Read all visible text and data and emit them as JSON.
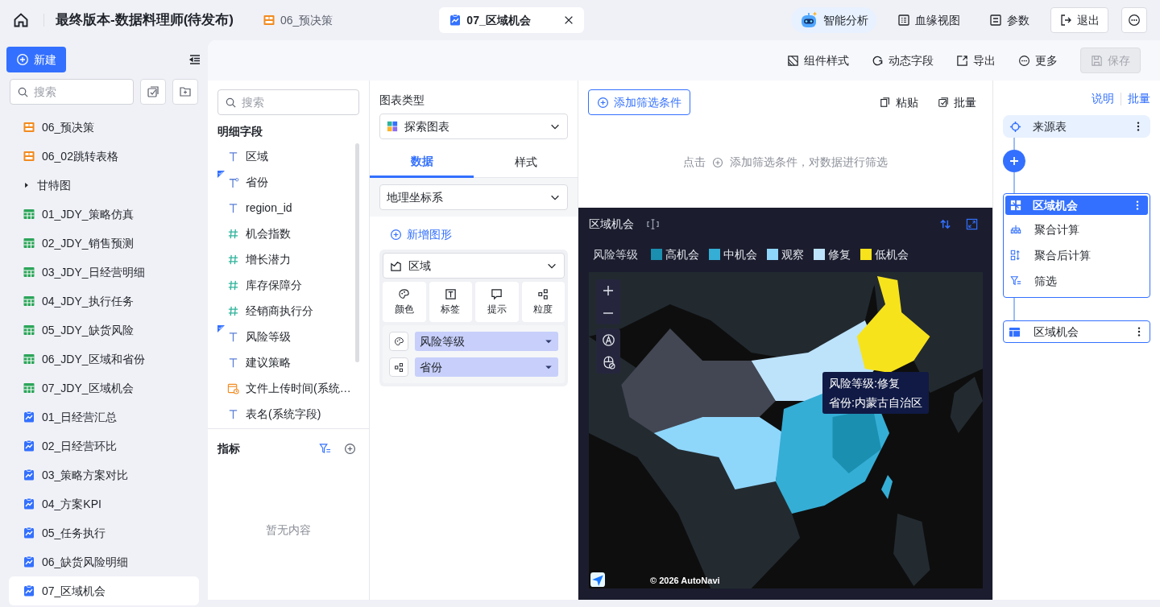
{
  "header": {
    "title": "最终版本-数据料理师(待发布)",
    "tabs": [
      {
        "label": "06_预决策",
        "kind": "dashboard",
        "selected": false
      },
      {
        "label": "07_区域机会",
        "kind": "chart",
        "selected": true
      }
    ],
    "actions": [
      {
        "label": "智能分析",
        "kind": "ai"
      },
      {
        "label": "血缘视图",
        "kind": "lineage"
      },
      {
        "label": "参数",
        "kind": "params"
      },
      {
        "label": "退出",
        "kind": "exit"
      }
    ]
  },
  "sidebar": {
    "new_button": "新建",
    "search_placeholder": "搜索",
    "items": [
      {
        "label": "06_预决策",
        "kind": "dashboard",
        "selected": false
      },
      {
        "label": "06_02跳转表格",
        "kind": "dashboard",
        "selected": false
      },
      {
        "label": "甘特图",
        "kind": "folder",
        "selected": false,
        "expanded": false
      },
      {
        "label": "01_JDY_策略仿真",
        "kind": "table",
        "selected": false
      },
      {
        "label": "02_JDY_销售预测",
        "kind": "table",
        "selected": false
      },
      {
        "label": "03_JDY_日经营明细",
        "kind": "table",
        "selected": false
      },
      {
        "label": "04_JDY_执行任务",
        "kind": "table",
        "selected": false
      },
      {
        "label": "05_JDY_缺货风险",
        "kind": "table",
        "selected": false
      },
      {
        "label": "06_JDY_区域和省份",
        "kind": "table",
        "selected": false
      },
      {
        "label": "07_JDY_区域机会",
        "kind": "table",
        "selected": false
      },
      {
        "label": "01_日经营汇总",
        "kind": "chart",
        "selected": false
      },
      {
        "label": "02_日经营环比",
        "kind": "chart",
        "selected": false
      },
      {
        "label": "03_策略方案对比",
        "kind": "chart",
        "selected": false
      },
      {
        "label": "04_方案KPI",
        "kind": "chart",
        "selected": false
      },
      {
        "label": "05_任务执行",
        "kind": "chart",
        "selected": false
      },
      {
        "label": "06_缺货风险明细",
        "kind": "chart",
        "selected": false
      },
      {
        "label": "07_区域机会",
        "kind": "chart",
        "selected": true
      }
    ]
  },
  "toolbar": [
    {
      "label": "组件样式",
      "kind": "style",
      "disabled": false
    },
    {
      "label": "动态字段",
      "kind": "dynamic",
      "disabled": false
    },
    {
      "label": "导出",
      "kind": "export",
      "disabled": false
    },
    {
      "label": "更多",
      "kind": "more",
      "disabled": false
    },
    {
      "label": "保存",
      "kind": "save",
      "disabled": true
    }
  ],
  "fields_panel": {
    "search_placeholder": "搜索",
    "detail_title": "明细字段",
    "fields": [
      {
        "label": "区域",
        "kind": "text",
        "used": false
      },
      {
        "label": "省份",
        "kind": "geo",
        "used": true
      },
      {
        "label": "region_id",
        "kind": "text",
        "used": false
      },
      {
        "label": "机会指数",
        "kind": "number",
        "used": false
      },
      {
        "label": "增长潜力",
        "kind": "number",
        "used": false
      },
      {
        "label": "库存保障分",
        "kind": "number",
        "used": false
      },
      {
        "label": "经销商执行分",
        "kind": "number",
        "used": false
      },
      {
        "label": "风险等级",
        "kind": "text",
        "used": true
      },
      {
        "label": "建议策略",
        "kind": "text",
        "used": false
      },
      {
        "label": "文件上传时间(系统…",
        "kind": "date",
        "used": false
      },
      {
        "label": "表名(系统字段)",
        "kind": "text",
        "used": false
      }
    ],
    "measures_title": "指标",
    "empty_text": "暂无内容"
  },
  "chart_config": {
    "type_label": "图表类型",
    "type_value": "探索图表",
    "tabs": [
      {
        "label": "数据",
        "selected": true
      },
      {
        "label": "样式",
        "selected": false
      }
    ],
    "coordinate": "地理坐标系",
    "add_shape": "新增图形",
    "layer": "区域",
    "channels": [
      {
        "label": "颜色",
        "kind": "color"
      },
      {
        "label": "标签",
        "kind": "label"
      },
      {
        "label": "提示",
        "kind": "tooltip"
      },
      {
        "label": "粒度",
        "kind": "detail"
      }
    ],
    "bindings": [
      {
        "kind": "color",
        "field": "风险等级"
      },
      {
        "kind": "detail",
        "field": "省份"
      }
    ]
  },
  "filter": {
    "add_button": "添加筛选条件",
    "actions": [
      {
        "label": "粘贴",
        "kind": "paste"
      },
      {
        "label": "批量",
        "kind": "batch"
      }
    ],
    "hint_prefix": "点击",
    "hint_text": "添加筛选条件，对数据进行筛选"
  },
  "chart": {
    "title": "区域机会",
    "legend_title": "风险等级",
    "legend": [
      {
        "label": "高机会",
        "color": "#1a8fb0"
      },
      {
        "label": "中机会",
        "color": "#35aed6"
      },
      {
        "label": "观察",
        "color": "#8fd6fb"
      },
      {
        "label": "修复",
        "color": "#bde3fb"
      },
      {
        "label": "低机会",
        "color": "#f7e31b"
      }
    ],
    "tooltip": [
      "风险等级:修复",
      "省份:内蒙古自治区"
    ],
    "attribution": "© 2026 AutoNavi"
  },
  "flow": {
    "links": [
      "说明",
      "批量"
    ],
    "source": "来源表",
    "node": {
      "title": "区域机会",
      "steps": [
        {
          "label": "聚合计算",
          "kind": "aggregate"
        },
        {
          "label": "聚合后计算",
          "kind": "post"
        },
        {
          "label": "筛选",
          "kind": "filter"
        }
      ]
    },
    "output": "区域机会"
  }
}
